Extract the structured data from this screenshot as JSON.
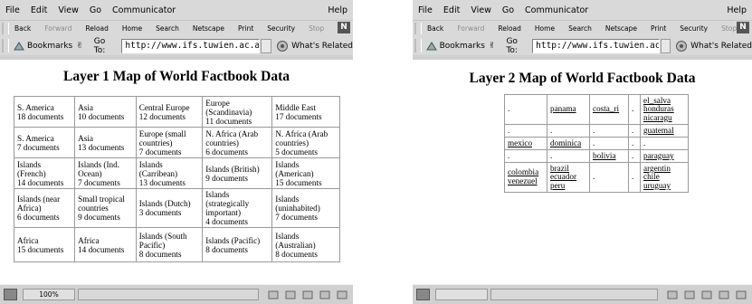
{
  "windows": [
    {
      "menu": [
        "File",
        "Edit",
        "View",
        "Go",
        "Communicator"
      ],
      "menu_help": "Help",
      "nav": [
        "Back",
        "Forward",
        "Reload",
        "Home",
        "Search",
        "Netscape",
        "Print",
        "Security",
        "Stop"
      ],
      "logo": "N",
      "bookmarks_label": "Bookmarks",
      "goto_label": "Go To:",
      "url": "http://www.ifs.tuwien.ac.at/",
      "whats_related": "What's Related",
      "page_title": "Layer 1 Map of World Factbook Data",
      "zoom": "100%",
      "table": [
        [
          [
            "S. America",
            "18 documents"
          ],
          [
            "Asia",
            "10 documents"
          ],
          [
            "Central Europe",
            "12 documents"
          ],
          [
            "Europe",
            "(Scandinavia)",
            "11 documents"
          ],
          [
            "Middle East",
            "17 documents"
          ]
        ],
        [
          [
            "S. America",
            "7 documents"
          ],
          [
            "Asia",
            "13 documents"
          ],
          [
            "Europe (small",
            "countries)",
            "7 documents"
          ],
          [
            "N. Africa (Arab",
            "countries)",
            "6 documents"
          ],
          [
            "N. Africa (Arab",
            "countries)",
            "5 documents"
          ]
        ],
        [
          [
            "Islands",
            "(French)",
            "14 documents"
          ],
          [
            "Islands (Ind.",
            "Ocean)",
            "7 documents"
          ],
          [
            "Islands",
            "(Carribean)",
            "13 documents"
          ],
          [
            "Islands (British)",
            "9 documents"
          ],
          [
            "Islands",
            "(American)",
            "15 documents"
          ]
        ],
        [
          [
            "Islands (near",
            "Africa)",
            "6 documents"
          ],
          [
            "Small tropical",
            "countries",
            "9 documents"
          ],
          [
            "Islands (Dutch)",
            "3 documents"
          ],
          [
            "Islands",
            "(strategically",
            "important)",
            "4 documents"
          ],
          [
            "Islands",
            "(uninhabited)",
            "7 documents"
          ]
        ],
        [
          [
            "Africa",
            "15 documents"
          ],
          [
            "Africa",
            "14 documents"
          ],
          [
            "Islands (South",
            "Pacific)",
            "8 documents"
          ],
          [
            "Islands (Pacific)",
            "8 documents"
          ],
          [
            "Islands",
            "(Australian)",
            "8 documents"
          ]
        ]
      ]
    },
    {
      "menu": [
        "File",
        "Edit",
        "View",
        "Go",
        "Communicator"
      ],
      "menu_help": "Help",
      "nav": [
        "Back",
        "Forward",
        "Reload",
        "Home",
        "Search",
        "Netscape",
        "Print",
        "Security",
        "Stop"
      ],
      "logo": "N",
      "bookmarks_label": "Bookmarks",
      "goto_label": "Go To:",
      "url": "http://www.ifs.tuwien.ac.at/",
      "whats_related": "What's Related",
      "page_title": "Layer 2 Map of World Factbook Data",
      "table": [
        [
          [
            "."
          ],
          [
            "panama"
          ],
          [
            "costa_ri"
          ],
          [
            "."
          ],
          [
            "el_salva",
            "honduras",
            "nicaragu"
          ]
        ],
        [
          [
            "."
          ],
          [
            "."
          ],
          [
            "."
          ],
          [
            "."
          ],
          [
            "guatemal"
          ]
        ],
        [
          [
            "mexico"
          ],
          [
            "dominica"
          ],
          [
            "."
          ],
          [
            "."
          ],
          [
            "."
          ]
        ],
        [
          [
            "."
          ],
          [
            "."
          ],
          [
            "bolivia"
          ],
          [
            "."
          ],
          [
            "paraguay"
          ]
        ],
        [
          [
            "colombia",
            "venezuel"
          ],
          [
            "brazil",
            "ecuador",
            "peru"
          ],
          [
            "."
          ],
          [
            "."
          ],
          [
            "argentin",
            "chile",
            "uruguay"
          ]
        ]
      ]
    }
  ]
}
